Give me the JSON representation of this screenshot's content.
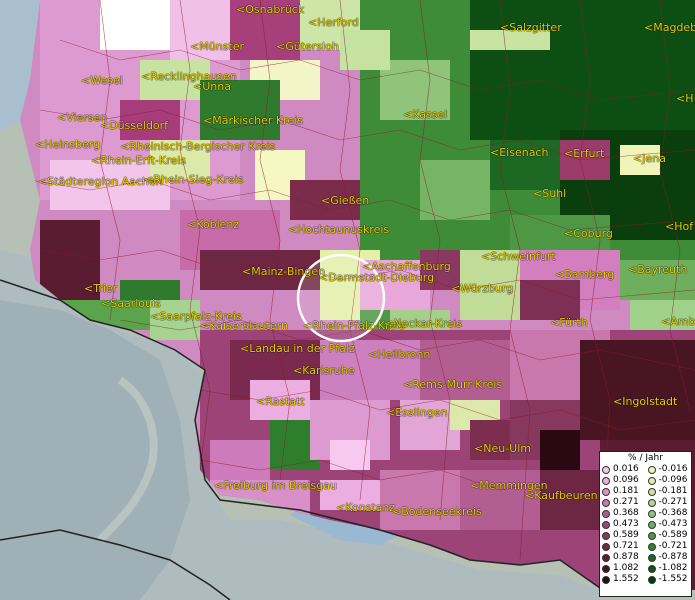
{
  "colors": {
    "sea": "#9fb7c9",
    "land_relief": "#b9c3b5",
    "border": "#8a1a2a"
  },
  "labels": [
    {
      "id": "osnabrueck",
      "text": "<Osnabrück"
    },
    {
      "id": "herford",
      "text": "<Herford"
    },
    {
      "id": "salzgitter",
      "text": "<Salzgitter"
    },
    {
      "id": "magdeburg",
      "text": "<Magdeb"
    },
    {
      "id": "muenster",
      "text": "<Münster"
    },
    {
      "id": "guetersloh",
      "text": "<Gütersloh"
    },
    {
      "id": "wesel",
      "text": "<Wesel"
    },
    {
      "id": "recklinghausen",
      "text": "<Recklinghausen"
    },
    {
      "id": "unna",
      "text": "<Unna"
    },
    {
      "id": "h_right",
      "text": "<H"
    },
    {
      "id": "viersen",
      "text": "<Viersen"
    },
    {
      "id": "duesseldorf",
      "text": "<Düsseldorf"
    },
    {
      "id": "maerkischer",
      "text": "<Märkischer Kreis"
    },
    {
      "id": "kassel",
      "text": "<Kassel"
    },
    {
      "id": "heinsberg",
      "text": "<Heinsberg"
    },
    {
      "id": "rheinisch",
      "text": "<Rheinisch-Bergischer Kreis"
    },
    {
      "id": "eisenach",
      "text": "<Eisenach"
    },
    {
      "id": "erfurt",
      "text": "<Erfurt"
    },
    {
      "id": "jena",
      "text": "<Jena"
    },
    {
      "id": "rhein_erft",
      "text": "<Rhein-Erft-Kreis"
    },
    {
      "id": "aachen",
      "text": "<Städteregion Aachen"
    },
    {
      "id": "rhein_sieg",
      "text": "<Rhein-Sieg-Kreis"
    },
    {
      "id": "suhl",
      "text": "<Suhl"
    },
    {
      "id": "giessen",
      "text": "<Gießen"
    },
    {
      "id": "koblenz",
      "text": "<Koblenz"
    },
    {
      "id": "hochtaunus",
      "text": "<Hochtaunuskreis"
    },
    {
      "id": "coburg",
      "text": "<Coburg"
    },
    {
      "id": "hof",
      "text": "<Hof"
    },
    {
      "id": "schweinfurt",
      "text": "<Schweinfurt"
    },
    {
      "id": "mainz_bingen",
      "text": "<Mainz-Bingen"
    },
    {
      "id": "aschaffenburg",
      "text": "<Aschaffenburg"
    },
    {
      "id": "darmstadt",
      "text": "<Darmstadt-Dieburg"
    },
    {
      "id": "bamberg",
      "text": "<Bamberg"
    },
    {
      "id": "bayreuth",
      "text": "<Bayreuth"
    },
    {
      "id": "trier",
      "text": "<Trier"
    },
    {
      "id": "wuerzburg",
      "text": "<Würzburg"
    },
    {
      "id": "saarlouis",
      "text": "<Saarlouis"
    },
    {
      "id": "kaiserslautern",
      "text": "<Kaiserslautern"
    },
    {
      "id": "rhein_pfalz",
      "text": "<Rhein-Pfalz-Kreis"
    },
    {
      "id": "neckar",
      "text": "<Neckar-Kreis"
    },
    {
      "id": "fuerth",
      "text": "<Fürth"
    },
    {
      "id": "amberg",
      "text": "<Amb"
    },
    {
      "id": "saarpfalz",
      "text": "<Saarpfalz-Kreis"
    },
    {
      "id": "landau",
      "text": "<Landau in der Pfalz"
    },
    {
      "id": "heilbronn",
      "text": "<Heilbronn"
    },
    {
      "id": "karlsruhe",
      "text": "<Karlsruhe"
    },
    {
      "id": "rems_murr",
      "text": "<Rems-Murr-Kreis"
    },
    {
      "id": "rastatt",
      "text": "<Rastatt"
    },
    {
      "id": "ingolstadt",
      "text": "<Ingolstadt"
    },
    {
      "id": "esslingen",
      "text": "<Esslingen"
    },
    {
      "id": "neu_ulm",
      "text": "<Neu-Ulm"
    },
    {
      "id": "freiburg",
      "text": "<Freiburg im Breisgau"
    },
    {
      "id": "memmingen",
      "text": "<Memmingen"
    },
    {
      "id": "kaufbeuren",
      "text": "<Kaufbeuren"
    },
    {
      "id": "konstanz",
      "text": "<Konstanz"
    },
    {
      "id": "bodensee",
      "text": "<Bodenseekreis"
    }
  ],
  "legend": {
    "title": "% / Jahr",
    "rows": [
      {
        "pos": "0.016",
        "neg": "-0.016",
        "pos_color": "#f5c6ee",
        "neg_color": "#f0f4b8"
      },
      {
        "pos": "0.096",
        "neg": "-0.096",
        "pos_color": "#ecaee0",
        "neg_color": "#dcedb0"
      },
      {
        "pos": "0.181",
        "neg": "-0.181",
        "pos_color": "#db93c8",
        "neg_color": "#c8e3a2"
      },
      {
        "pos": "0.271",
        "neg": "-0.271",
        "pos_color": "#c978ad",
        "neg_color": "#afd58f"
      },
      {
        "pos": "0.368",
        "neg": "-0.368",
        "pos_color": "#b25e92",
        "neg_color": "#91c376"
      },
      {
        "pos": "0.473",
        "neg": "-0.473",
        "pos_color": "#9a4774",
        "neg_color": "#6fae5c"
      },
      {
        "pos": "0.589",
        "neg": "-0.589",
        "pos_color": "#86385f",
        "neg_color": "#4e9745"
      },
      {
        "pos": "0.721",
        "neg": "-0.721",
        "pos_color": "#6e2742",
        "neg_color": "#318132"
      },
      {
        "pos": "0.878",
        "neg": "-0.878",
        "pos_color": "#5a1c30",
        "neg_color": "#1d6924"
      },
      {
        "pos": "1.082",
        "neg": "-1.082",
        "pos_color": "#431220",
        "neg_color": "#0f5217"
      },
      {
        "pos": "1.552",
        "neg": "-1.552",
        "pos_color": "#2b0912",
        "neg_color": "#053a0c"
      }
    ]
  }
}
